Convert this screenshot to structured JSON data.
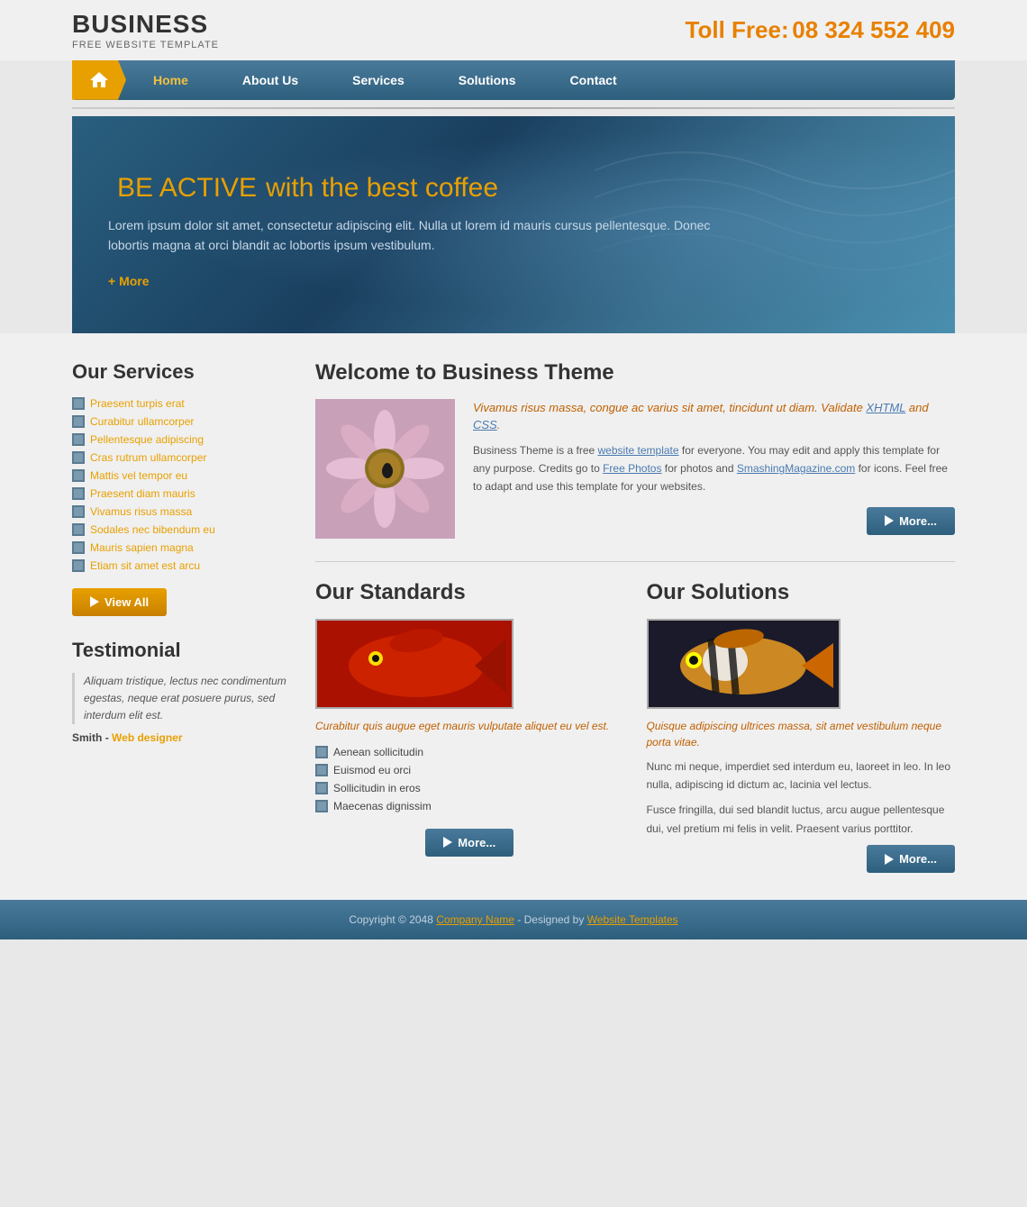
{
  "header": {
    "logo_title": "BUSINESS",
    "logo_subtitle": "FREE WEBSITE TEMPLATE",
    "toll_free_label": "Toll Free:",
    "toll_free_number": "08 324 552 409"
  },
  "nav": {
    "items": [
      {
        "label": "Home",
        "active": true
      },
      {
        "label": "About Us",
        "active": false
      },
      {
        "label": "Services",
        "active": false
      },
      {
        "label": "Solutions",
        "active": false
      },
      {
        "label": "Contact",
        "active": false
      }
    ]
  },
  "hero": {
    "title_main": "BE ACTIVE",
    "title_accent": "with the best coffee",
    "description": "Lorem ipsum dolor sit amet, consectetur adipiscing elit. Nulla ut lorem id mauris cursus pellentesque. Donec lobortis magna at orci blandit ac lobortis ipsum vestibulum.",
    "more_link": "More"
  },
  "sidebar": {
    "services_title": "Our Services",
    "services_list": [
      "Praesent turpis erat",
      "Curabitur ullamcorper",
      "Pellentesque adipiscing",
      "Cras rutrum ullamcorper",
      "Mattis vel tempor eu",
      "Praesent diam mauris",
      "Vivamus risus massa",
      "Sodales nec bibendum eu",
      "Mauris sapien magna",
      "Etiam sit amet est arcu"
    ],
    "view_all_btn": "View All",
    "testimonial_title": "Testimonial",
    "testimonial_text": "Aliquam tristique, lectus nec condimentum egestas, neque erat posuere purus, sed interdum elit est.",
    "testimonial_author": "Smith",
    "testimonial_role": "Web designer"
  },
  "welcome": {
    "title": "Welcome to Business Theme",
    "italic_text": "Vivamus risus massa, congue ac varius sit amet, tincidunt ut diam. Validate XHTML and CSS.",
    "body_text": "Business Theme is a free website template for everyone. You may edit and apply this template for any purpose. Credits go to Free Photos for photos and SmashingMagazine.com for icons. Feel free to adapt and use this template for your websites.",
    "more_btn": "More..."
  },
  "standards": {
    "title": "Our Standards",
    "italic_text": "Curabitur quis augue eget mauris vulputate aliquet eu vel est.",
    "list": [
      "Aenean sollicitudin",
      "Euismod eu orci",
      "Sollicitudin in eros",
      "Maecenas dignissim"
    ],
    "more_btn": "More..."
  },
  "solutions": {
    "title": "Our Solutions",
    "italic_text": "Quisque adipiscing ultrices massa, sit amet vestibulum neque porta vitae.",
    "body1": "Nunc mi neque, imperdiet sed interdum eu, laoreet in leo. In leo nulla, adipiscing id dictum ac, lacinia vel lectus.",
    "body2": "Fusce fringilla, dui sed blandit luctus, arcu augue pellentesque dui, vel pretium mi felis in velit. Praesent varius porttitor.",
    "more_btn": "More..."
  },
  "footer": {
    "copyright": "Copyright © 2048",
    "company_name": "Company Name",
    "designed_by": "Designed by",
    "website_templates": "Website Templates"
  }
}
